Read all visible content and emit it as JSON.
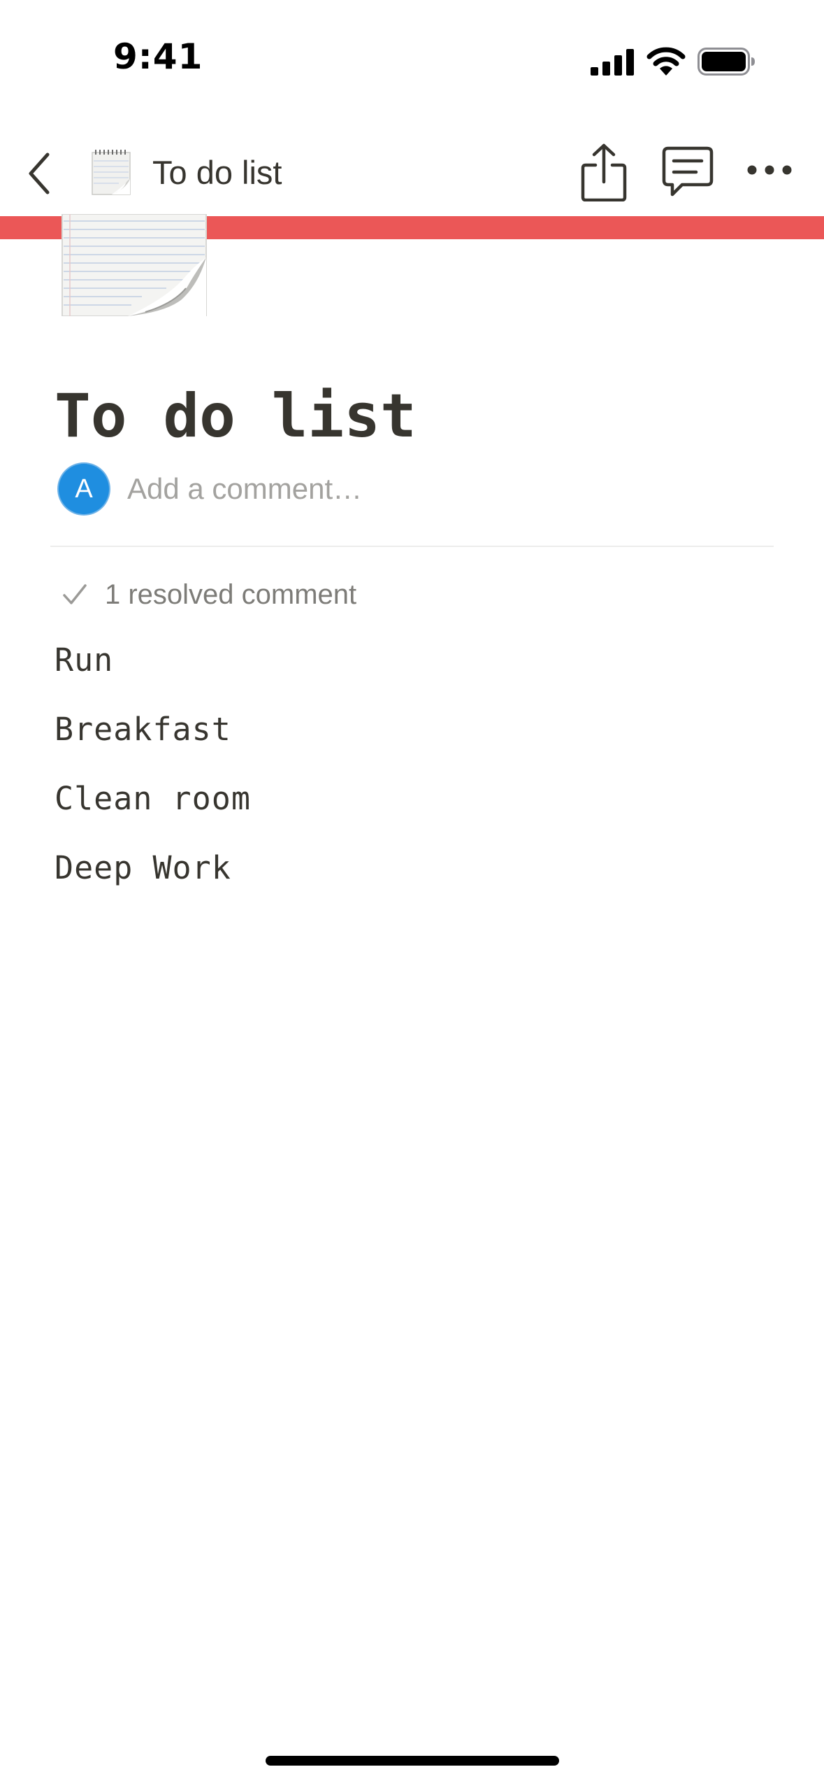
{
  "status_bar": {
    "time": "9:41"
  },
  "nav": {
    "title": "To do list",
    "icons": [
      "back-icon",
      "notepad-icon",
      "share-icon",
      "comments-icon",
      "more-icon"
    ]
  },
  "cover": {
    "color": "#eb5757"
  },
  "page": {
    "title": "To do list",
    "icon": "notepad-icon"
  },
  "comment": {
    "avatar_letter": "A",
    "avatar_color": "#1f8ee0",
    "placeholder": "Add a comment…"
  },
  "resolved": {
    "label": "1 resolved comment"
  },
  "blocks": [
    "Run",
    "Breakfast",
    "Clean room",
    "Deep Work"
  ]
}
